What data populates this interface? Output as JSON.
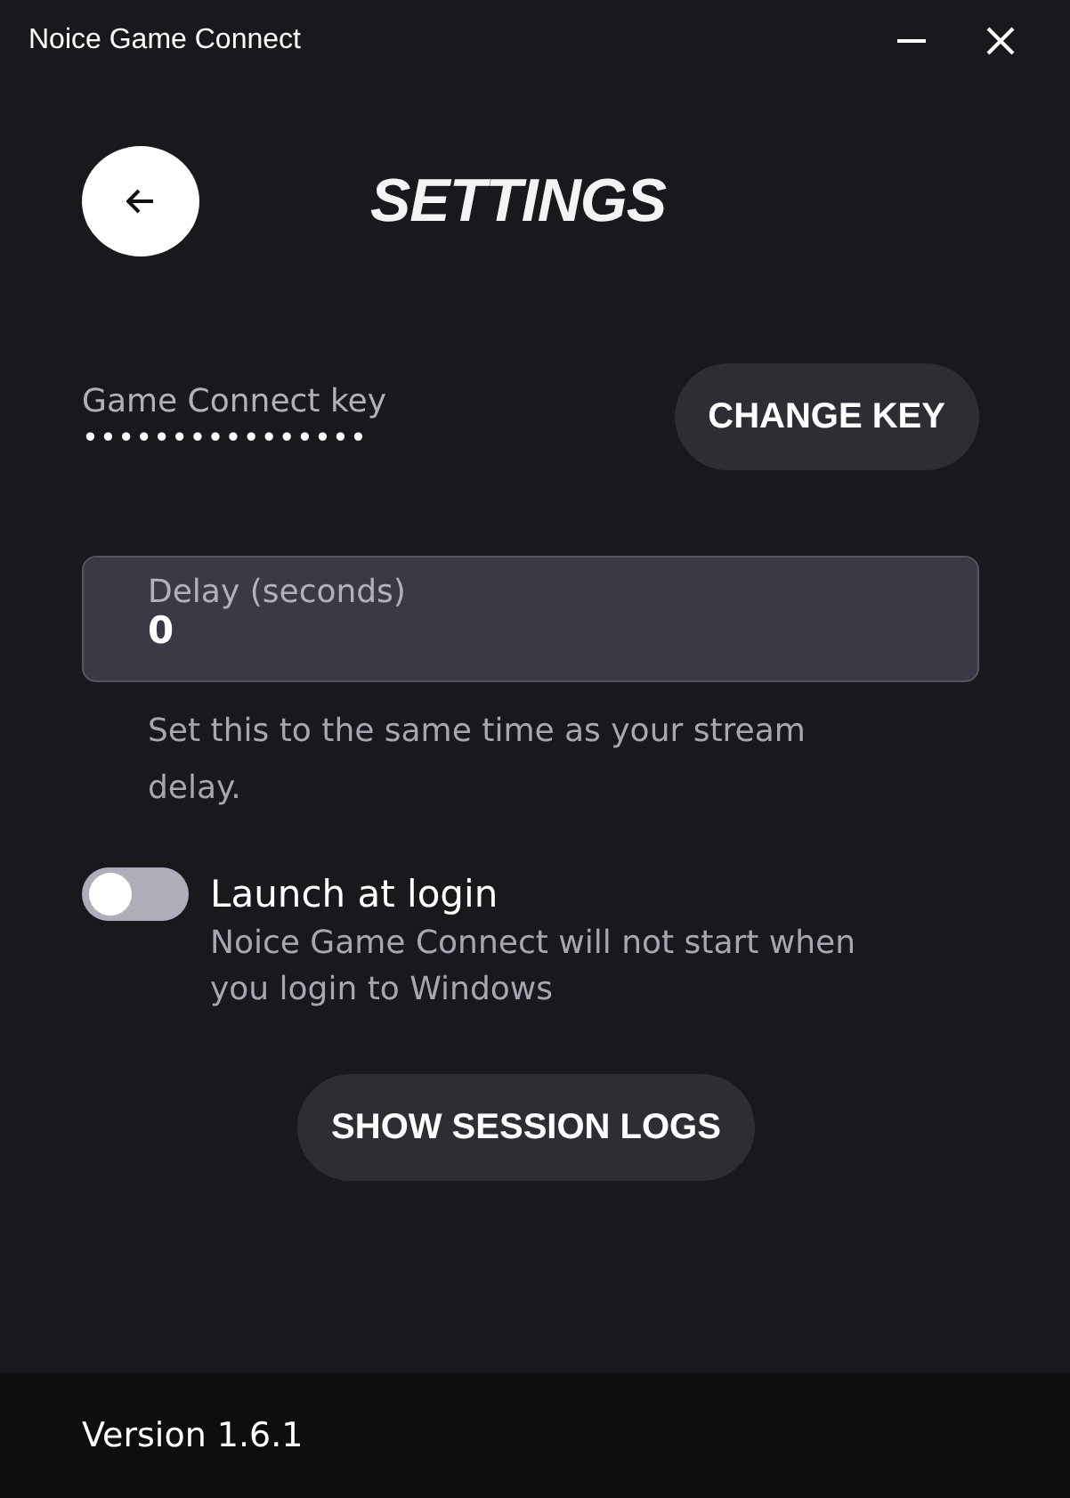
{
  "window": {
    "title": "Noice Game Connect",
    "controls": [
      {
        "kind": "minimize"
      },
      {
        "kind": "close"
      }
    ]
  },
  "header": {
    "title": "SETTINGS"
  },
  "key": {
    "label": "Game Connect key",
    "value": "••••••••••••••••",
    "button": "CHANGE KEY"
  },
  "delay": {
    "label": "Delay (seconds)",
    "value": "0",
    "help": "Set this to the same time as your stream delay."
  },
  "launch": {
    "label": "Launch at login",
    "description": "Noice Game Connect will not start when you login to Windows",
    "on": false
  },
  "logs_button": "SHOW SESSION LOGS",
  "footer": {
    "version": "Version 1.6.1"
  }
}
